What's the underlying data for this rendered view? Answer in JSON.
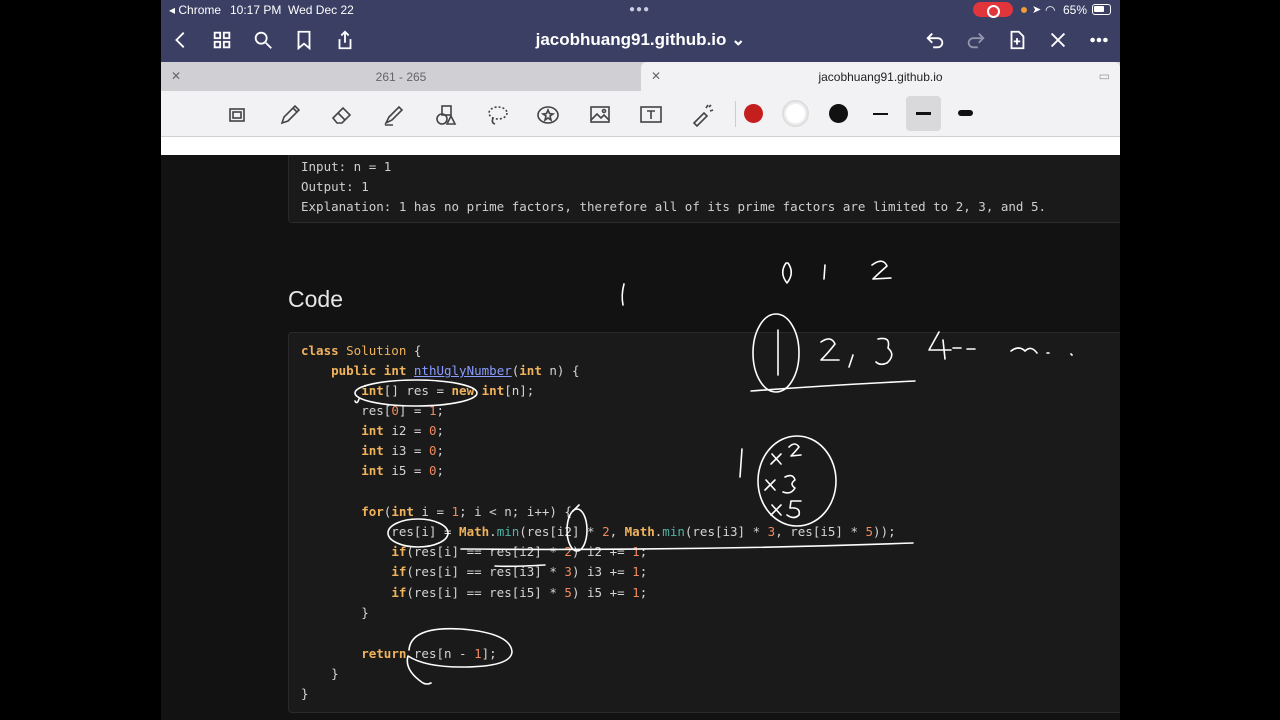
{
  "status_bar": {
    "app": "◂ Chrome",
    "time": "10:17 PM",
    "date": "Wed Dec 22",
    "battery": "65%"
  },
  "nav": {
    "url_title": "jacobhuang91.github.io ⌄"
  },
  "tabs": [
    {
      "label": "261 - 265",
      "active": false
    },
    {
      "label": "jacobhuang91.github.io",
      "active": true
    }
  ],
  "toolbar": {
    "colors": [
      "#c41e1e",
      "#ffffff",
      "#111111"
    ]
  },
  "example": {
    "input": "Input: n = 1",
    "output": "Output: 1",
    "explanation": "Explanation: 1 has no prime factors, therefore all of its prime factors are limited to 2, 3, and 5."
  },
  "section": {
    "heading": "Code"
  },
  "code": {
    "l1a": "class ",
    "l1b": "Solution",
    "l1c": " {",
    "l2a": "    public ",
    "l2b": "int ",
    "l2c": "nthUglyNumber",
    "l2d": "(",
    "l2e": "int",
    "l2f": " n) {",
    "l3a": "        ",
    "l3b": "int",
    "l3c": "[] res = ",
    "l3d": "new ",
    "l3e": "int",
    "l3f": "[n];",
    "l4a": "        res[",
    "l4b": "0",
    "l4c": "] = ",
    "l4d": "1",
    "l4e": ";",
    "l5a": "        ",
    "l5b": "int",
    "l5c": " i2 = ",
    "l5d": "0",
    "l5e": ";",
    "l6a": "        ",
    "l6b": "int",
    "l6c": " i3 = ",
    "l6d": "0",
    "l6e": ";",
    "l7a": "        ",
    "l7b": "int",
    "l7c": " i5 = ",
    "l7d": "0",
    "l7e": ";",
    "l8a": "        ",
    "l8b": "for",
    "l8c": "(",
    "l8d": "int",
    "l8e": " i = ",
    "l8f": "1",
    "l8g": "; i < n; i++) {",
    "l9a": "            res[i] = ",
    "l9b": "Math",
    "l9c": ".",
    "l9d": "min",
    "l9e": "(res[i2] * ",
    "l9f": "2",
    "l9g": ", ",
    "l9h": "Math",
    "l9i": ".",
    "l9j": "min",
    "l9k": "(res[i3] * ",
    "l9l": "3",
    "l9m": ", res[i5] * ",
    "l9n": "5",
    "l9o": "));",
    "l10a": "            ",
    "l10b": "if",
    "l10c": "(res[i] == res[i2] * ",
    "l10d": "2",
    "l10e": ") i2 += ",
    "l10f": "1",
    "l10g": ";",
    "l11a": "            ",
    "l11b": "if",
    "l11c": "(res[i] == res[i3] * ",
    "l11d": "3",
    "l11e": ") i3 += ",
    "l11f": "1",
    "l11g": ";",
    "l12a": "            ",
    "l12b": "if",
    "l12c": "(res[i] == res[i5] * ",
    "l12d": "5",
    "l12e": ") i5 += ",
    "l12f": "1",
    "l12g": ";",
    "l13": "        }",
    "l14a": "        ",
    "l14b": "return",
    "l14c": " res[n - ",
    "l14d": "1",
    "l14e": "];",
    "l15": "    }",
    "l16": "}"
  }
}
